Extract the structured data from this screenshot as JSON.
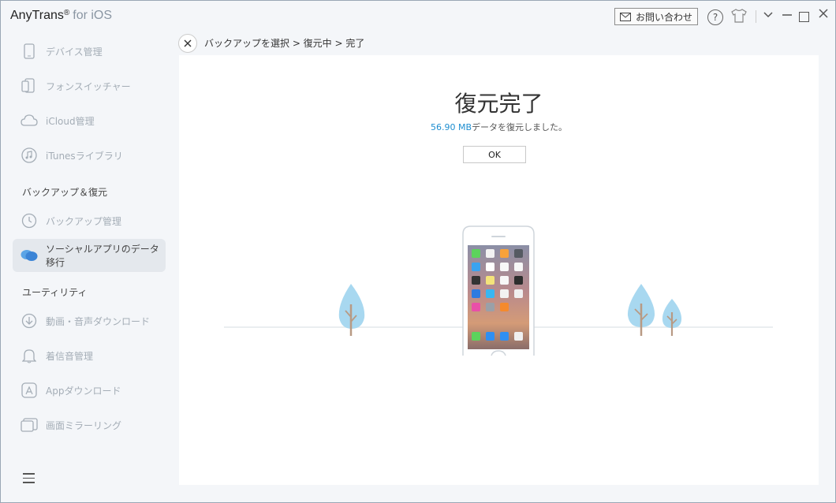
{
  "app": {
    "name": "AnyTrans",
    "reg": "®",
    "suffix": "for iOS",
    "contact_label": "お問い合わせ",
    "help_glyph": "?"
  },
  "sidebar": {
    "items": [
      {
        "label": "デバイス管理",
        "icon": "phone-icon"
      },
      {
        "label": "フォンスイッチャー",
        "icon": "phone-switch-icon"
      },
      {
        "label": "iCloud管理",
        "icon": "cloud-icon"
      },
      {
        "label": "iTunesライブラリ",
        "icon": "music-icon"
      }
    ],
    "section_backup": "バックアップ＆復元",
    "backup_items": [
      {
        "label": "バックアップ管理",
        "icon": "history-icon"
      },
      {
        "label": "ソーシャルアプリのデータ移行",
        "icon": "chat-bubbles-icon",
        "active": true
      }
    ],
    "section_utility": "ユーティリティ",
    "utility_items": [
      {
        "label": "動画・音声ダウンロード",
        "icon": "download-icon"
      },
      {
        "label": "着信音管理",
        "icon": "bell-icon"
      },
      {
        "label": "Appダウンロード",
        "icon": "app-store-icon"
      },
      {
        "label": "画面ミラーリング",
        "icon": "mirror-icon"
      }
    ]
  },
  "breadcrumb": {
    "text": "バックアップを選択 > 復元中 > 完了"
  },
  "result": {
    "title": "復元完了",
    "size": "56.90 MB",
    "message": "データを復元しました。",
    "ok_label": "OK"
  },
  "colors": {
    "accent": "#1e8ed0",
    "tree": "#a8d8f0",
    "trunk": "#b89a84"
  }
}
